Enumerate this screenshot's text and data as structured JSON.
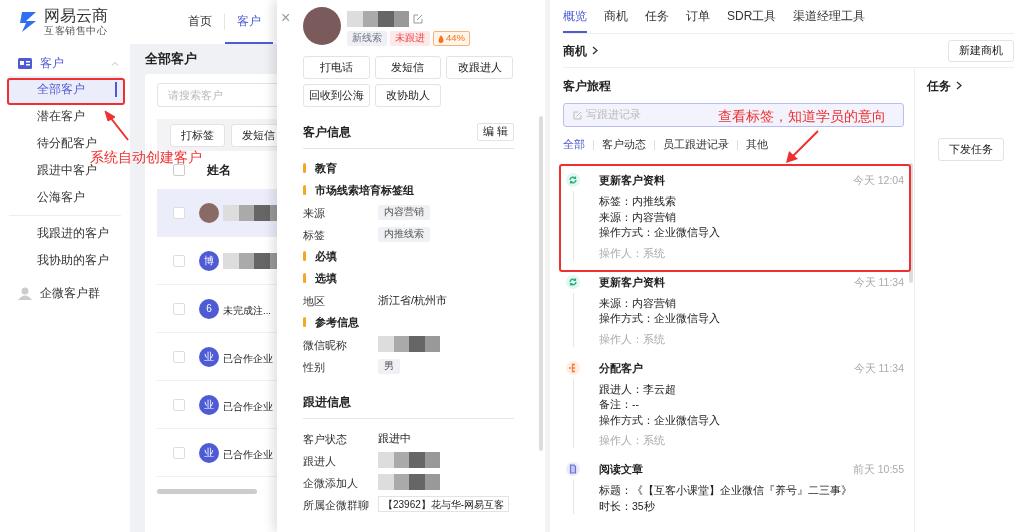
{
  "app": {
    "logo": {
      "name": "网易云商",
      "subtitle": "互客销售中心"
    },
    "nav": [
      {
        "label": "首页",
        "selected": false
      },
      {
        "label": "客户",
        "selected": true
      }
    ]
  },
  "sidebar": {
    "group": {
      "label": "客户",
      "expanded": true
    },
    "items": [
      {
        "label": "全部客户",
        "selected": true
      },
      {
        "label": "潜在客户",
        "selected": false
      },
      {
        "label": "待分配客户",
        "selected": false
      },
      {
        "label": "跟进中客户",
        "selected": false
      },
      {
        "label": "公海客户",
        "selected": false
      }
    ],
    "my_items": [
      {
        "label": "我跟进的客户",
        "selected": false
      },
      {
        "label": "我协助的客户",
        "selected": false
      }
    ],
    "footer_group": {
      "label": "企微客户群"
    }
  },
  "customer_list": {
    "title": "全部客户",
    "search": {
      "placeholder": "请搜索客户"
    },
    "buttons": [
      "打标签",
      "发短信"
    ],
    "columns": [
      "姓名"
    ],
    "all_checked": false,
    "rows": [
      {
        "selected": true,
        "checked": false,
        "avatar": {
          "kind": "photo"
        },
        "name": {
          "kind": "redacted"
        }
      },
      {
        "selected": false,
        "checked": false,
        "avatar": {
          "kind": "letter",
          "text": "博"
        },
        "name": {
          "kind": "redacted"
        }
      },
      {
        "selected": false,
        "checked": false,
        "avatar": {
          "kind": "letter",
          "text": "6"
        },
        "name": {
          "kind": "text",
          "text": "未完成注..."
        }
      },
      {
        "selected": false,
        "checked": false,
        "avatar": {
          "kind": "letter",
          "text": "业"
        },
        "name": {
          "kind": "text",
          "text": "已合作企业"
        }
      },
      {
        "selected": false,
        "checked": false,
        "avatar": {
          "kind": "letter",
          "text": "业"
        },
        "name": {
          "kind": "text",
          "text": "已合作企业"
        }
      },
      {
        "selected": false,
        "checked": false,
        "avatar": {
          "kind": "letter",
          "text": "业"
        },
        "name": {
          "kind": "text",
          "text": "已合作企业"
        }
      }
    ]
  },
  "detail": {
    "close": "×",
    "tags": [
      {
        "label": "新线索",
        "kind": "neutral"
      },
      {
        "label": "未跟进",
        "kind": "warning"
      },
      {
        "label": "44%",
        "kind": "heat"
      }
    ],
    "actions": [
      "打电话",
      "发短信",
      "改跟进人",
      "回收到公海",
      "改协助人"
    ],
    "sections": [
      {
        "title": "客户信息",
        "edit_button": "编 辑",
        "rows": [
          {
            "kind": "group",
            "label": "教育"
          },
          {
            "kind": "group",
            "label": "市场线索培育标签组"
          },
          {
            "kind": "field",
            "label": "来源",
            "value": {
              "kind": "tag",
              "text": "内容营销"
            }
          },
          {
            "kind": "field",
            "label": "标签",
            "value": {
              "kind": "tag",
              "text": "内推线索"
            }
          },
          {
            "kind": "group",
            "label": "必填"
          },
          {
            "kind": "group",
            "label": "选填"
          },
          {
            "kind": "field",
            "label": "地区",
            "value": {
              "kind": "text",
              "text": "浙江省/杭州市"
            }
          },
          {
            "kind": "group",
            "label": "参考信息"
          },
          {
            "kind": "field",
            "label": "微信昵称",
            "value": {
              "kind": "redacted"
            }
          },
          {
            "kind": "field",
            "label": "性别",
            "value": {
              "kind": "tag",
              "text": "男"
            }
          }
        ]
      },
      {
        "title": "跟进信息",
        "rows": [
          {
            "kind": "field",
            "label": "客户状态",
            "value": {
              "kind": "text",
              "text": "跟进中"
            }
          },
          {
            "kind": "field",
            "label": "跟进人",
            "value": {
              "kind": "redacted"
            }
          },
          {
            "kind": "field",
            "label": "企微添加人",
            "value": {
              "kind": "redacted"
            }
          },
          {
            "kind": "field",
            "label": "所属企微群聊",
            "value": {
              "kind": "box",
              "text": "【23962】花与华-网易互客"
            }
          }
        ]
      }
    ]
  },
  "overview": {
    "tabs": [
      {
        "label": "概览",
        "selected": true
      },
      {
        "label": "商机",
        "selected": false
      },
      {
        "label": "任务",
        "selected": false
      },
      {
        "label": "订单",
        "selected": false
      },
      {
        "label": "SDR工具",
        "selected": false
      },
      {
        "label": "渠道经理工具",
        "selected": false
      }
    ],
    "opportunity": {
      "title": "商机",
      "button": "新建商机"
    },
    "journey": {
      "title": "客户旅程",
      "record_placeholder": "写跟进记录",
      "filters": [
        {
          "label": "全部",
          "selected": true
        },
        {
          "label": "客户动态",
          "selected": false
        },
        {
          "label": "员工跟进记录",
          "selected": false
        },
        {
          "label": "其他",
          "selected": false
        }
      ],
      "events": [
        {
          "kind": "update",
          "title": "更新客户资料",
          "time": "今天 12:04",
          "lines": [
            "标签：内推线索",
            "来源：内容营销",
            "操作方式：企业微信导入"
          ],
          "operator": "操作人：系统"
        },
        {
          "kind": "update",
          "title": "更新客户资料",
          "time": "今天 11:34",
          "lines": [
            "来源：内容营销",
            "操作方式：企业微信导入"
          ],
          "operator": "操作人：系统"
        },
        {
          "kind": "assign",
          "title": "分配客户",
          "time": "今天 11:34",
          "lines": [
            "跟进人：李云超",
            "备注：--",
            "操作方式：企业微信导入"
          ],
          "operator": "操作人：系统"
        },
        {
          "kind": "read",
          "title": "阅读文章",
          "time": "前天 10:55",
          "lines": [
            "标题：《【互客小课堂】企业微信『养号』二三事》",
            "时长：35秒"
          ]
        }
      ]
    },
    "tasks": {
      "title": "任务",
      "button": "下发任务"
    }
  },
  "annotations": [
    {
      "text": "系统自动创建客户"
    },
    {
      "text": "查看标签，知道学员的意向"
    }
  ]
}
